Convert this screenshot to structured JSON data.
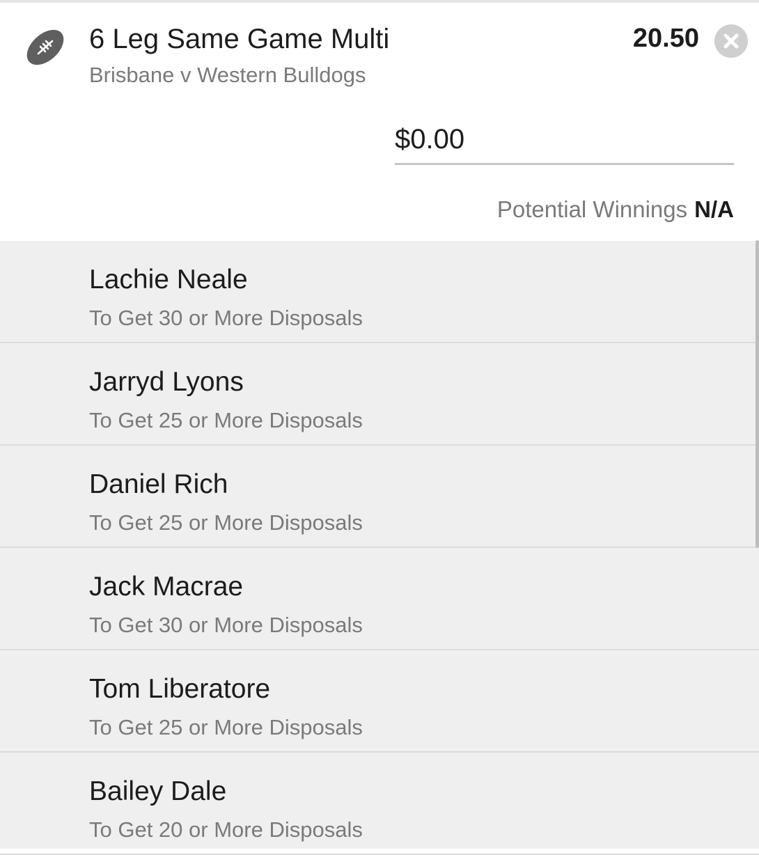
{
  "bet": {
    "icon": "football-icon",
    "title": "6 Leg Same Game Multi",
    "match": "Brisbane v Western Bulldogs",
    "odds": "20.50",
    "remove_icon": "close-icon"
  },
  "stake": {
    "value": "$0.00"
  },
  "winnings": {
    "label": "Potential Winnings",
    "value": "N/A"
  },
  "legs": [
    {
      "player": "Lachie Neale",
      "market": "To Get 30 or More Disposals"
    },
    {
      "player": "Jarryd Lyons",
      "market": "To Get 25 or More Disposals"
    },
    {
      "player": "Daniel Rich",
      "market": "To Get 25 or More Disposals"
    },
    {
      "player": "Jack Macrae",
      "market": "To Get 30 or More Disposals"
    },
    {
      "player": "Tom Liberatore",
      "market": "To Get 25 or More Disposals"
    },
    {
      "player": "Bailey Dale",
      "market": "To Get 20 or More Disposals"
    }
  ]
}
